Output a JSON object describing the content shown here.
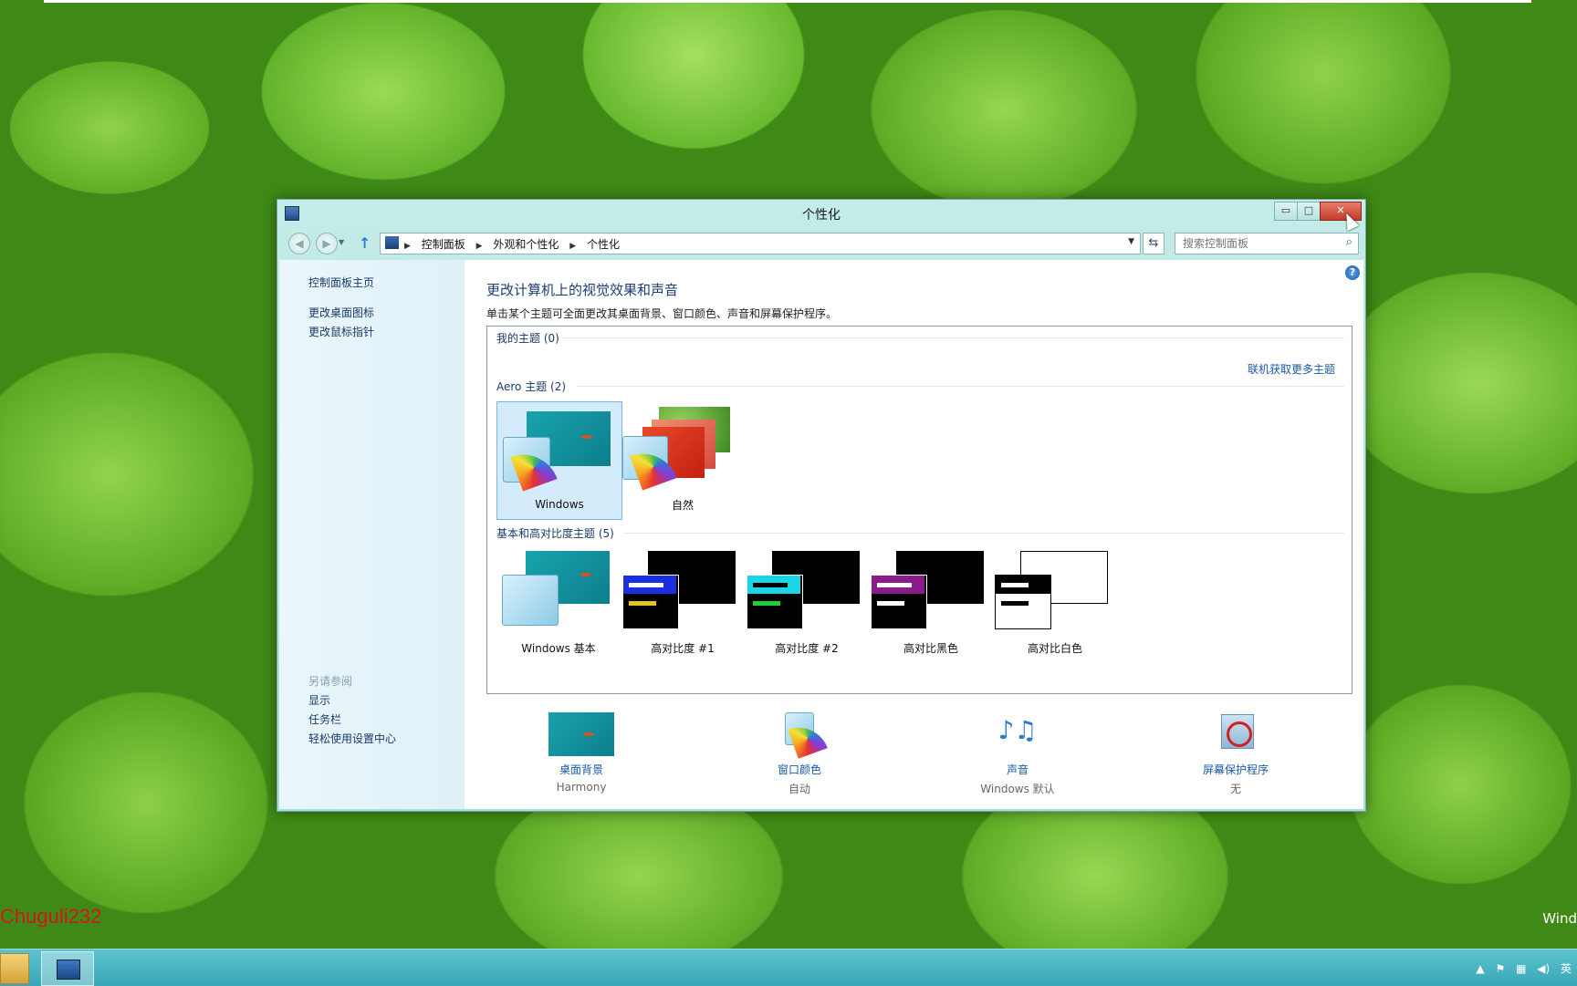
{
  "window": {
    "title": "个性化",
    "controls": {
      "minimize": "▭",
      "maximize": "□",
      "close": "✕"
    }
  },
  "address_bar": {
    "crumbs": [
      "控制面板",
      "外观和个性化",
      "个性化"
    ],
    "search_placeholder": "搜索控制面板"
  },
  "sidebar": {
    "home": "控制面板主页",
    "links": [
      "更改桌面图标",
      "更改鼠标指针"
    ],
    "see_also_heading": "另请参阅",
    "see_also": [
      "显示",
      "任务栏",
      "轻松使用设置中心"
    ]
  },
  "main": {
    "title": "更改计算机上的视觉效果和声音",
    "description": "单击某个主题可全面更改其桌面背景、窗口颜色、声音和屏幕保护程序。",
    "online_link": "联机获取更多主题",
    "sections": [
      {
        "heading": "我的主题 (0)"
      },
      {
        "heading": "Aero 主题 (2)",
        "themes": [
          "Windows",
          "自然"
        ],
        "selected": "Windows"
      },
      {
        "heading": "基本和高对比度主题 (5)",
        "themes": [
          "Windows 基本",
          "高对比度 #1",
          "高对比度 #2",
          "高对比黑色",
          "高对比白色"
        ]
      }
    ]
  },
  "bottom_bar": [
    {
      "label": "桌面背景",
      "value": "Harmony",
      "icon": "desktop-background-icon"
    },
    {
      "label": "窗口颜色",
      "value": "自动",
      "icon": "window-color-icon"
    },
    {
      "label": "声音",
      "value": "Windows 默认",
      "icon": "sound-icon"
    },
    {
      "label": "屏幕保护程序",
      "value": "无",
      "icon": "screensaver-icon"
    }
  ],
  "desktop": {
    "watermark": "Chuguli232",
    "corner_text": "Wind"
  },
  "taskbar": {
    "tray_language": "英"
  },
  "colors": {
    "link": "#1a5aa8",
    "heading": "#1e3d73",
    "selection": "#d4ebfb",
    "close_button": "#c43b2a",
    "taskbar": "#38a7b7"
  }
}
